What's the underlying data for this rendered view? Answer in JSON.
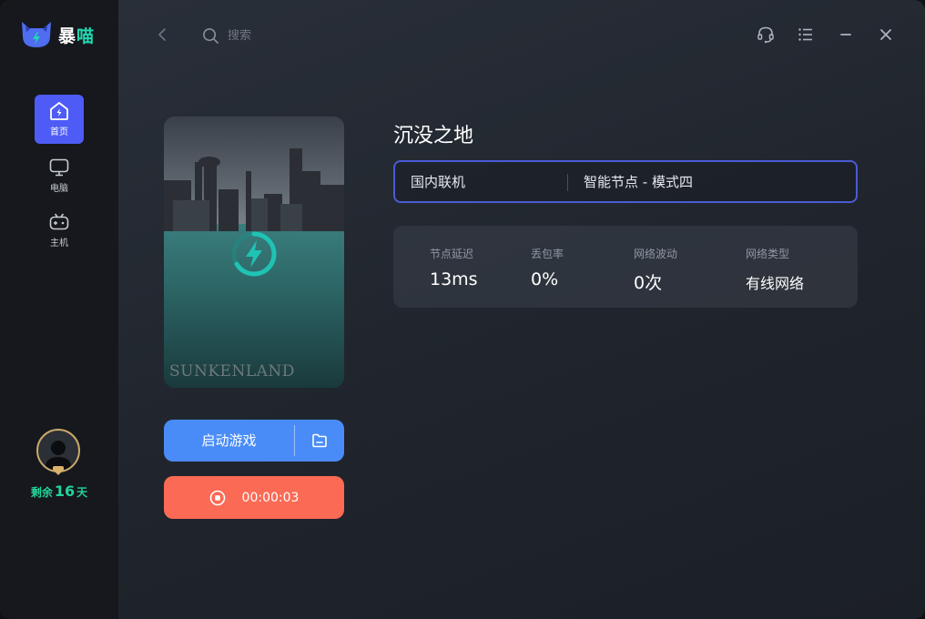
{
  "app": {
    "logo_text_a": "暴",
    "logo_text_b": "喵"
  },
  "sidebar": {
    "items": [
      {
        "label": "首页",
        "icon": "home-icon",
        "active": true
      },
      {
        "label": "电脑",
        "icon": "monitor-icon",
        "active": false
      },
      {
        "label": "主机",
        "icon": "gamepad-icon",
        "active": false
      }
    ],
    "remaining_prefix": "剩余",
    "remaining_days": "16",
    "remaining_suffix": "天"
  },
  "topbar": {
    "search_placeholder": "搜索"
  },
  "game": {
    "title": "沉没之地",
    "cover_title": "SUNKENLAND"
  },
  "actions": {
    "launch_label": "启动游戏",
    "timer": "00:00:03"
  },
  "mode": {
    "region": "国内联机",
    "node": "智能节点 - 模式四"
  },
  "stats": [
    {
      "label": "节点延迟",
      "value": "13ms"
    },
    {
      "label": "丢包率",
      "value": "0%"
    },
    {
      "label": "网络波动",
      "value": "0次"
    },
    {
      "label": "网络类型",
      "value": "有线网络"
    }
  ],
  "colors": {
    "accent": "#4e5cf5",
    "launch": "#4a8cf7",
    "stop": "#fb6a55",
    "brand_green": "#21d7b0",
    "vip_green": "#24d39a"
  }
}
